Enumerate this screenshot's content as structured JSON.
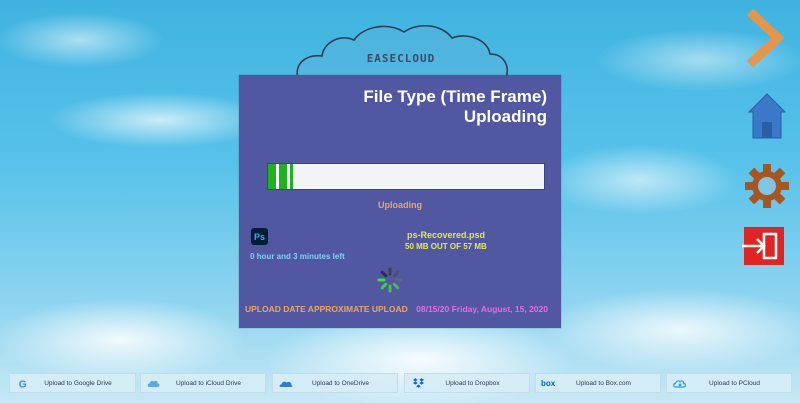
{
  "brand": "EASECLOUD",
  "panel": {
    "title": "File Type (Time Frame) Uploading",
    "progress_fraction": 0.09,
    "status": "Uploading",
    "file_icon_text": "Ps",
    "file_name": "ps-Recovered.psd",
    "file_size": "50 MB OUT OF 57 MB",
    "time_left": "0 hour and 3 minutes left",
    "upload_date_label": "UPLOAD DATE APPROXIMATE UPLOAD",
    "upload_date_value": "08/15/20 Friday, August, 15, 2020"
  },
  "nav": {
    "icons": [
      "chevron-right-icon",
      "home-icon",
      "gear-icon",
      "exit-icon"
    ]
  },
  "colors": {
    "panel_bg": "#5157a0",
    "progress_green": "#1fb21f",
    "status_orange": "#f0a65a",
    "file_yellow": "#e6e94a",
    "time_blue": "#7fd3f7",
    "date_magenta": "#e86be0",
    "nav_orange": "#e8944a",
    "nav_blue": "#3b78c9",
    "nav_brown": "#a8551f",
    "nav_red": "#e02424"
  },
  "bottom_bar": {
    "buttons": [
      {
        "label": "Upload to Google Drive",
        "icon": "google-icon"
      },
      {
        "label": "Upload to iCloud Drive",
        "icon": "icloud-icon"
      },
      {
        "label": "Upload to OneDrive",
        "icon": "onedrive-icon"
      },
      {
        "label": "Upload to Dropbox",
        "icon": "dropbox-icon"
      },
      {
        "label": "Upload to Box.com",
        "icon": "box-icon"
      },
      {
        "label": "Upload to PCloud",
        "icon": "pcloud-icon"
      }
    ]
  }
}
